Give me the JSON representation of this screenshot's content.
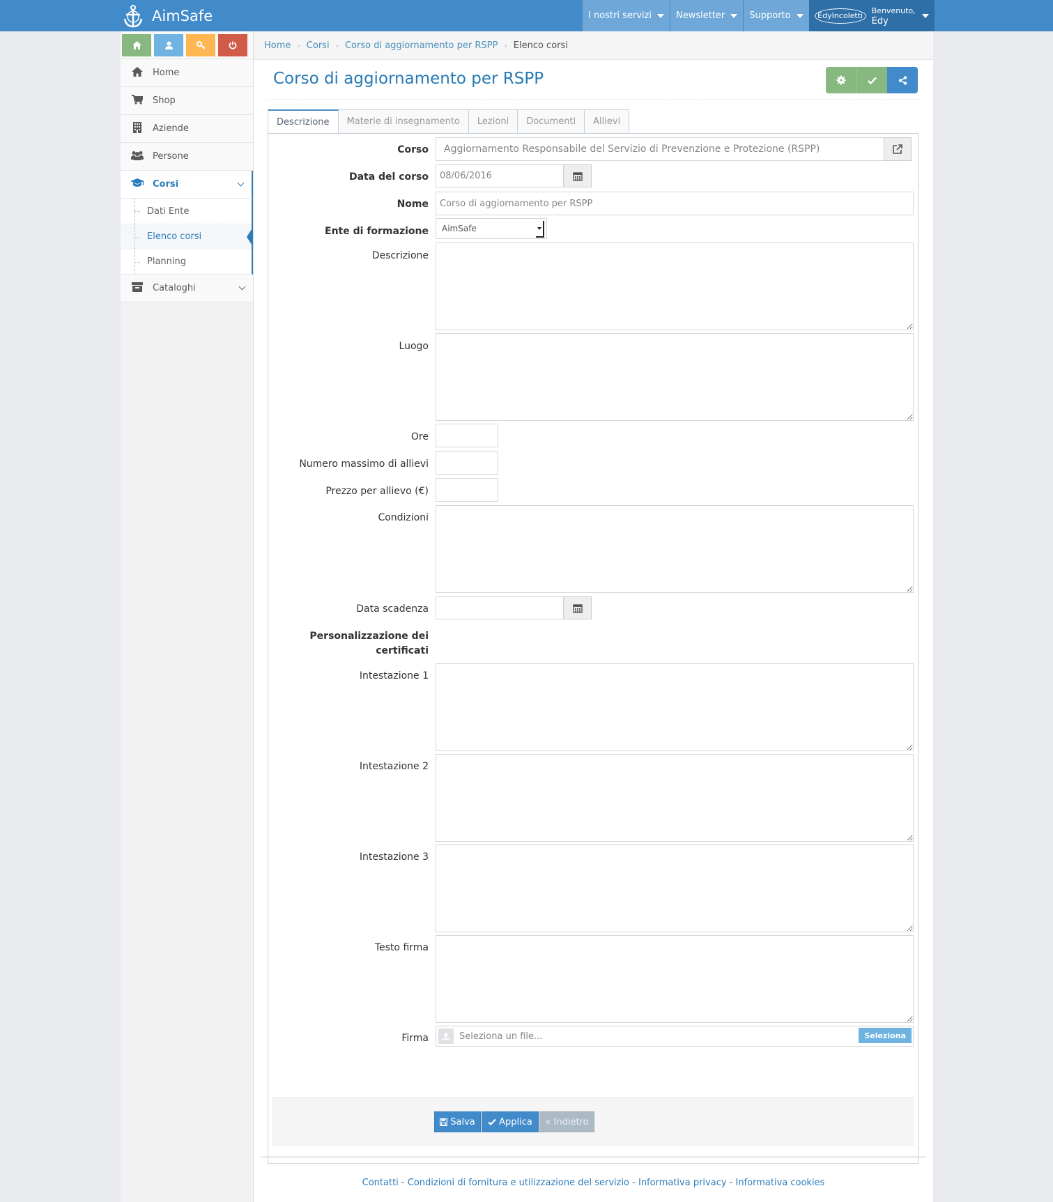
{
  "brand": {
    "name": "AimSafe",
    "logo_icon": "anchor-helm-icon"
  },
  "topnav": [
    {
      "label": "I nostri servizi"
    },
    {
      "label": "Newsletter"
    },
    {
      "label": "Supporto"
    }
  ],
  "user": {
    "avatar_text": "EdyIncoletti",
    "greeting": "Benvenuto,",
    "name": "Edy"
  },
  "shortcuts": [
    "home-icon",
    "user-icon",
    "key-icon",
    "power-icon"
  ],
  "sidebar": {
    "items": [
      {
        "label": "Home",
        "icon": "home-icon"
      },
      {
        "label": "Shop",
        "icon": "cart-icon"
      },
      {
        "label": "Aziende",
        "icon": "building-icon"
      },
      {
        "label": "Persone",
        "icon": "users-icon"
      },
      {
        "label": "Corsi",
        "icon": "graduation-cap-icon"
      },
      {
        "label": "Cataloghi",
        "icon": "archive-icon"
      }
    ],
    "submenu": [
      {
        "label": "Dati Ente"
      },
      {
        "label": "Elenco corsi"
      },
      {
        "label": "Planning"
      }
    ]
  },
  "breadcrumbs": [
    "Home",
    "Corsi",
    "Corso di aggiornamento per RSPP",
    "Elenco corsi"
  ],
  "page": {
    "title": "Corso di aggiornamento per RSPP"
  },
  "tabs": [
    "Descrizione",
    "Materie di insegnamento",
    "Lezioni",
    "Documenti",
    "Allievi"
  ],
  "form": {
    "corso_label": "Corso",
    "corso_value": "Aggiornamento Responsabile del Servizio di Prevenzione e Protezione (RSPP)",
    "data_label": "Data del corso",
    "data_value": "08/06/2016",
    "nome_label": "Nome",
    "nome_value": "Corso di aggiornamento per RSPP",
    "ente_label": "Ente di formazione",
    "ente_value": "AimSafe",
    "descrizione_label": "Descrizione",
    "luogo_label": "Luogo",
    "ore_label": "Ore",
    "max_label": "Numero massimo di allievi",
    "prezzo_label": "Prezzo per allievo (€)",
    "condizioni_label": "Condizioni",
    "scadenza_label": "Data scadenza",
    "cert_label_1": "Personalizzazione dei",
    "cert_label_2": "certificati",
    "int1_label": "Intestazione 1",
    "int2_label": "Intestazione 2",
    "int3_label": "Intestazione 3",
    "testo_firma_label": "Testo firma",
    "firma_label": "Firma",
    "file_placeholder": "Seleziona un file...",
    "file_button": "Seleziona"
  },
  "actions": {
    "save": "Salva",
    "apply": "Applica",
    "back": "« Indietro"
  },
  "footer": {
    "links": [
      "Contatti",
      "Condizioni di fornitura e utilizzazione del servizio",
      "Informativa privacy",
      "Informativa cookies"
    ],
    "separator": " - "
  }
}
